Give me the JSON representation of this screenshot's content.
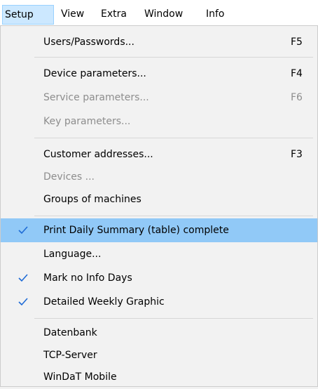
{
  "menubar": {
    "items": [
      {
        "label": "Setup"
      },
      {
        "label": "View"
      },
      {
        "label": "Extra"
      },
      {
        "label": "Window"
      },
      {
        "label": "Info"
      }
    ]
  },
  "dropdown": {
    "items": [
      {
        "label": "Users/Passwords...",
        "shortcut": "F5",
        "enabled": true
      },
      {
        "label": "Device parameters...",
        "shortcut": "F4",
        "enabled": true
      },
      {
        "label": "Service parameters...",
        "shortcut": "F6",
        "enabled": false
      },
      {
        "label": "Key parameters...",
        "shortcut": "",
        "enabled": false
      },
      {
        "label": "Customer addresses...",
        "shortcut": "F3",
        "enabled": true
      },
      {
        "label": "Devices ...",
        "shortcut": "",
        "enabled": false
      },
      {
        "label": "Groups of machines",
        "shortcut": "",
        "enabled": true
      },
      {
        "label": "Print Daily Summary (table) complete",
        "shortcut": "",
        "enabled": true,
        "checked": true,
        "highlighted": true
      },
      {
        "label": "Language...",
        "shortcut": "",
        "enabled": true
      },
      {
        "label": "Mark no Info Days",
        "shortcut": "",
        "enabled": true,
        "checked": true
      },
      {
        "label": "Detailed Weekly Graphic",
        "shortcut": "",
        "enabled": true,
        "checked": true
      },
      {
        "label": "Datenbank",
        "shortcut": "",
        "enabled": true
      },
      {
        "label": "TCP-Server",
        "shortcut": "",
        "enabled": true
      },
      {
        "label": "WinDaT Mobile",
        "shortcut": "",
        "enabled": true
      }
    ]
  },
  "colors": {
    "highlight": "#91c9f7",
    "disabled_text": "#8d8d8d",
    "checkmark": "#1e6bd6"
  }
}
